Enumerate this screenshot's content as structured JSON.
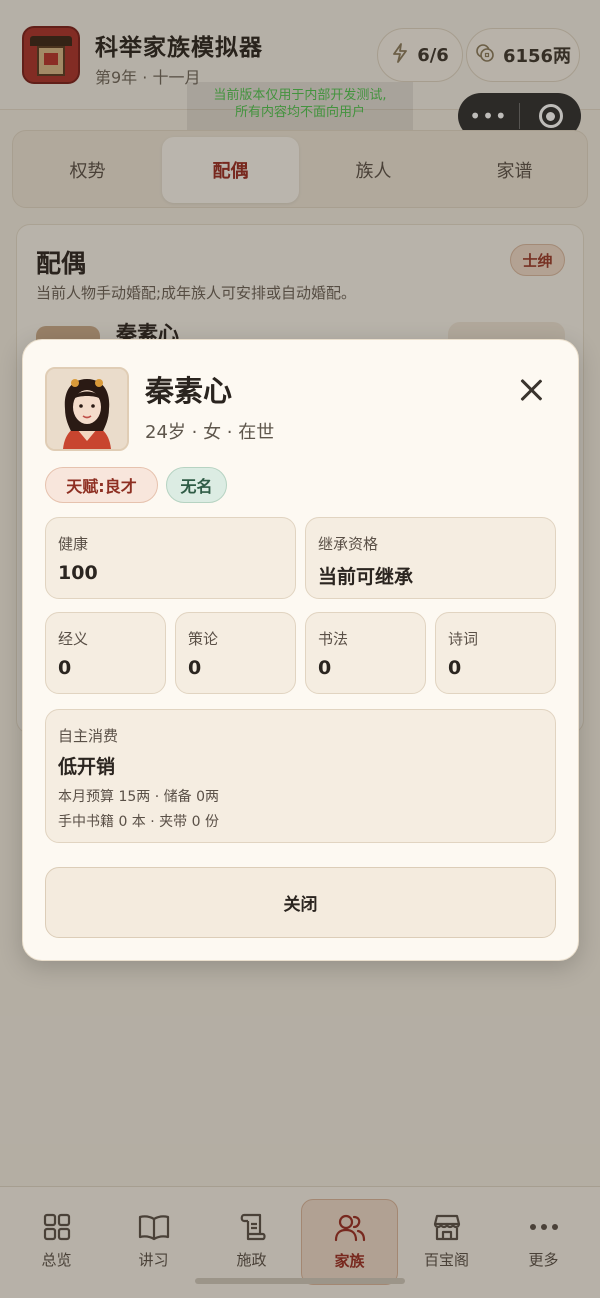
{
  "app": {
    "title": "科举家族模拟器",
    "date": "第9年 · 十一月"
  },
  "resources": {
    "energy": "6/6",
    "energy_icon": "lightning-icon",
    "silver": "6156两",
    "silver_icon": "coins-icon"
  },
  "dev_notice": {
    "line1": "当前版本仅用于内部开发测试,",
    "line2": "所有内容均不面向用户"
  },
  "tabs": [
    {
      "label": "权势",
      "active": false
    },
    {
      "label": "配偶",
      "active": true
    },
    {
      "label": "族人",
      "active": false
    },
    {
      "label": "家谱",
      "active": false
    }
  ],
  "background_card": {
    "heading": "配偶",
    "badge": "士绅",
    "description": "当前人物手动婚配;成年族人可安排或自动婚配。",
    "spouse_name": "秦素心"
  },
  "modal": {
    "name": "秦素心",
    "meta": "24岁 · 女 · 在世",
    "tags": {
      "talent": "天赋:良才",
      "fame": "无名"
    },
    "health": {
      "label": "健康",
      "value": "100"
    },
    "inheritance": {
      "label": "继承资格",
      "value": "当前可继承"
    },
    "skills": [
      {
        "label": "经义",
        "value": "0"
      },
      {
        "label": "策论",
        "value": "0"
      },
      {
        "label": "书法",
        "value": "0"
      },
      {
        "label": "诗词",
        "value": "0"
      }
    ],
    "spending": {
      "label": "自主消费",
      "value": "低开销",
      "line1": "本月预算 15两 · 储备 0两",
      "line2": "手中书籍 0 本 · 夹带 0 份"
    },
    "close_label": "关闭"
  },
  "bottom_nav": [
    {
      "label": "总览",
      "icon": "grid-icon",
      "active": false
    },
    {
      "label": "讲习",
      "icon": "book-icon",
      "active": false
    },
    {
      "label": "施政",
      "icon": "scroll-icon",
      "active": false
    },
    {
      "label": "家族",
      "icon": "people-icon",
      "active": true
    },
    {
      "label": "百宝阁",
      "icon": "shop-icon",
      "active": false
    },
    {
      "label": "更多",
      "icon": "more-icon",
      "active": false
    }
  ],
  "colors": {
    "accent": "#9a2b22",
    "background": "#f1ebe0",
    "modal": "#fdf9f2"
  }
}
